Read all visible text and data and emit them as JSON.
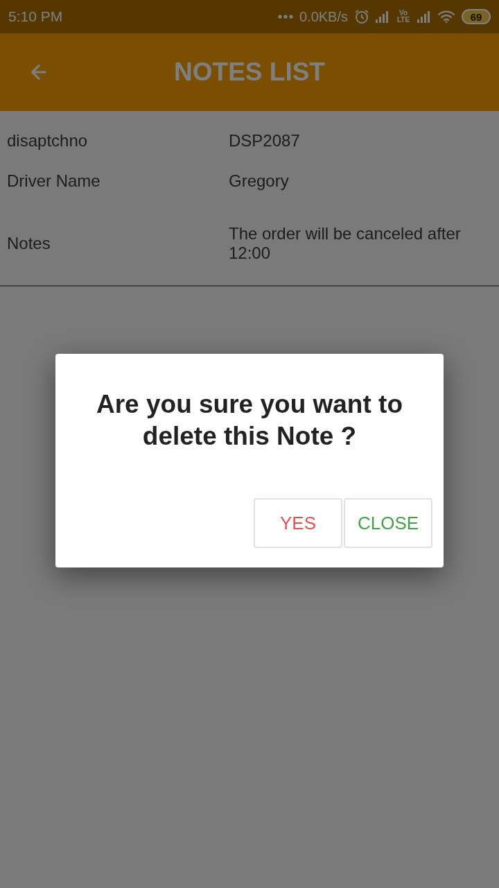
{
  "status_bar": {
    "time": "5:10 PM",
    "network_speed": "0.0KB/s",
    "network_badge": "Vo LTE",
    "battery": "69"
  },
  "app_bar": {
    "title": "NOTES LIST"
  },
  "details": [
    {
      "label": "disaptchno",
      "value": "DSP2087"
    },
    {
      "label": "Driver Name",
      "value": "Gregory"
    },
    {
      "label": "Notes",
      "value": "The order will be canceled after 12:00"
    }
  ],
  "dialog": {
    "message": "Are you sure you want to delete this Note ?",
    "buttons": [
      {
        "label": "YES",
        "kind": "confirm"
      },
      {
        "label": "CLOSE",
        "kind": "dismiss"
      }
    ]
  }
}
